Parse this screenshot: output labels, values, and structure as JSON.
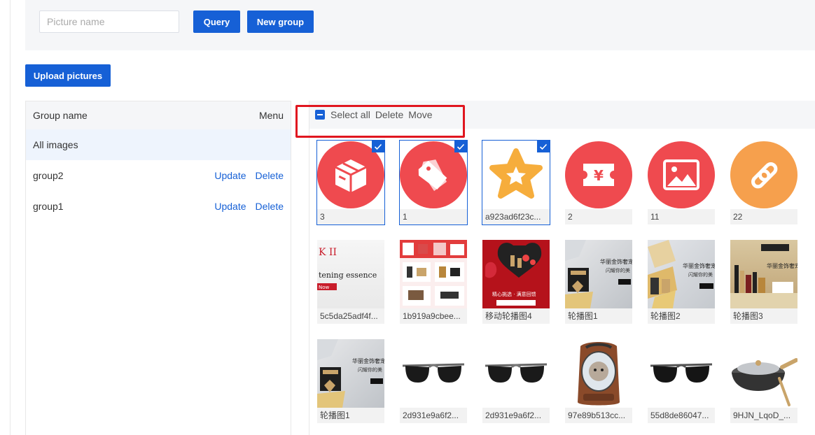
{
  "search": {
    "placeholder": "Picture name"
  },
  "buttons": {
    "query": "Query",
    "new_group": "New group",
    "upload": "Upload pictures"
  },
  "groups": {
    "header_name": "Group name",
    "header_menu": "Menu",
    "items": [
      {
        "name": "All images",
        "active": true
      },
      {
        "name": "group2",
        "update": "Update",
        "delete": "Delete"
      },
      {
        "name": "group1",
        "update": "Update",
        "delete": "Delete"
      }
    ]
  },
  "toolbar": {
    "select_all": "Select all",
    "delete": "Delete",
    "move": "Move"
  },
  "colors": {
    "primary": "#1660d6",
    "highlight": "#e0161f",
    "red_icon": "#ef4a4f",
    "orange_icon": "#f6a04d"
  },
  "images": [
    {
      "label": "3",
      "selected": true,
      "icon": "box-icon"
    },
    {
      "label": "1",
      "selected": true,
      "icon": "tag-icon"
    },
    {
      "label": "a923ad6f23c...",
      "selected": true,
      "icon": "star-icon"
    },
    {
      "label": "2",
      "icon": "coupon-icon"
    },
    {
      "label": "11",
      "icon": "picture-icon"
    },
    {
      "label": "22",
      "icon": "link-icon"
    },
    {
      "label": "5c5da25adf4f...",
      "icon": "skincare-banner-photo"
    },
    {
      "label": "1b919a9cbee...",
      "icon": "product-collage-photo"
    },
    {
      "label": "移动轮播图4",
      "icon": "gift-box-photo"
    },
    {
      "label": "轮播图1",
      "icon": "lipstick-box-photo"
    },
    {
      "label": "轮播图2",
      "icon": "gold-cosmetics-photo"
    },
    {
      "label": "轮播图3",
      "icon": "cosmetics-shelf-photo"
    },
    {
      "label": "轮播图1",
      "icon": "lipstick-box-photo"
    },
    {
      "label": "2d931e9a6f2...",
      "icon": "sunglasses-photo"
    },
    {
      "label": "2d931e9a6f2...",
      "icon": "sunglasses-photo"
    },
    {
      "label": "97e89b513cc...",
      "icon": "pet-backpack-photo"
    },
    {
      "label": "55d8de86047...",
      "icon": "sunglasses-photo"
    },
    {
      "label": "9HJN_LqoD_...",
      "icon": "wok-pan-photo"
    }
  ]
}
